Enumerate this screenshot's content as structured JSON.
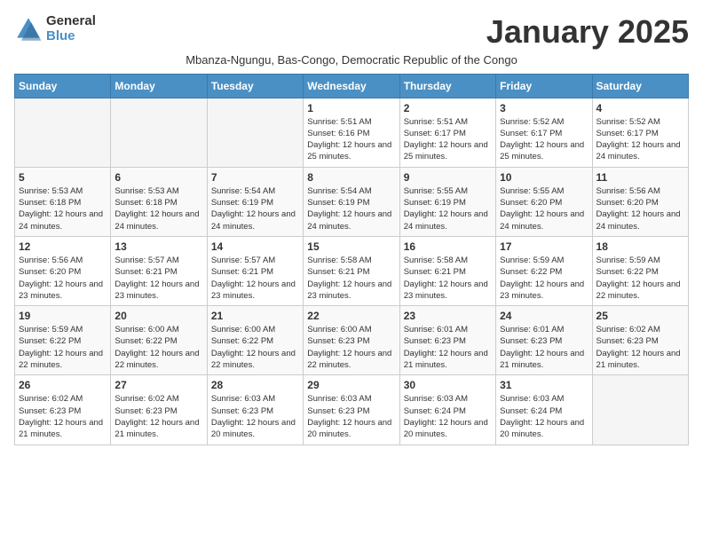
{
  "logo": {
    "general": "General",
    "blue": "Blue"
  },
  "title": "January 2025",
  "subtitle": "Mbanza-Ngungu, Bas-Congo, Democratic Republic of the Congo",
  "days_of_week": [
    "Sunday",
    "Monday",
    "Tuesday",
    "Wednesday",
    "Thursday",
    "Friday",
    "Saturday"
  ],
  "weeks": [
    [
      {
        "day": "",
        "empty": true
      },
      {
        "day": "",
        "empty": true
      },
      {
        "day": "",
        "empty": true
      },
      {
        "day": "1",
        "sunrise": "5:51 AM",
        "sunset": "6:16 PM",
        "daylight": "12 hours and 25 minutes."
      },
      {
        "day": "2",
        "sunrise": "5:51 AM",
        "sunset": "6:17 PM",
        "daylight": "12 hours and 25 minutes."
      },
      {
        "day": "3",
        "sunrise": "5:52 AM",
        "sunset": "6:17 PM",
        "daylight": "12 hours and 25 minutes."
      },
      {
        "day": "4",
        "sunrise": "5:52 AM",
        "sunset": "6:17 PM",
        "daylight": "12 hours and 24 minutes."
      }
    ],
    [
      {
        "day": "5",
        "sunrise": "5:53 AM",
        "sunset": "6:18 PM",
        "daylight": "12 hours and 24 minutes."
      },
      {
        "day": "6",
        "sunrise": "5:53 AM",
        "sunset": "6:18 PM",
        "daylight": "12 hours and 24 minutes."
      },
      {
        "day": "7",
        "sunrise": "5:54 AM",
        "sunset": "6:19 PM",
        "daylight": "12 hours and 24 minutes."
      },
      {
        "day": "8",
        "sunrise": "5:54 AM",
        "sunset": "6:19 PM",
        "daylight": "12 hours and 24 minutes."
      },
      {
        "day": "9",
        "sunrise": "5:55 AM",
        "sunset": "6:19 PM",
        "daylight": "12 hours and 24 minutes."
      },
      {
        "day": "10",
        "sunrise": "5:55 AM",
        "sunset": "6:20 PM",
        "daylight": "12 hours and 24 minutes."
      },
      {
        "day": "11",
        "sunrise": "5:56 AM",
        "sunset": "6:20 PM",
        "daylight": "12 hours and 24 minutes."
      }
    ],
    [
      {
        "day": "12",
        "sunrise": "5:56 AM",
        "sunset": "6:20 PM",
        "daylight": "12 hours and 23 minutes."
      },
      {
        "day": "13",
        "sunrise": "5:57 AM",
        "sunset": "6:21 PM",
        "daylight": "12 hours and 23 minutes."
      },
      {
        "day": "14",
        "sunrise": "5:57 AM",
        "sunset": "6:21 PM",
        "daylight": "12 hours and 23 minutes."
      },
      {
        "day": "15",
        "sunrise": "5:58 AM",
        "sunset": "6:21 PM",
        "daylight": "12 hours and 23 minutes."
      },
      {
        "day": "16",
        "sunrise": "5:58 AM",
        "sunset": "6:21 PM",
        "daylight": "12 hours and 23 minutes."
      },
      {
        "day": "17",
        "sunrise": "5:59 AM",
        "sunset": "6:22 PM",
        "daylight": "12 hours and 23 minutes."
      },
      {
        "day": "18",
        "sunrise": "5:59 AM",
        "sunset": "6:22 PM",
        "daylight": "12 hours and 22 minutes."
      }
    ],
    [
      {
        "day": "19",
        "sunrise": "5:59 AM",
        "sunset": "6:22 PM",
        "daylight": "12 hours and 22 minutes."
      },
      {
        "day": "20",
        "sunrise": "6:00 AM",
        "sunset": "6:22 PM",
        "daylight": "12 hours and 22 minutes."
      },
      {
        "day": "21",
        "sunrise": "6:00 AM",
        "sunset": "6:22 PM",
        "daylight": "12 hours and 22 minutes."
      },
      {
        "day": "22",
        "sunrise": "6:00 AM",
        "sunset": "6:23 PM",
        "daylight": "12 hours and 22 minutes."
      },
      {
        "day": "23",
        "sunrise": "6:01 AM",
        "sunset": "6:23 PM",
        "daylight": "12 hours and 21 minutes."
      },
      {
        "day": "24",
        "sunrise": "6:01 AM",
        "sunset": "6:23 PM",
        "daylight": "12 hours and 21 minutes."
      },
      {
        "day": "25",
        "sunrise": "6:02 AM",
        "sunset": "6:23 PM",
        "daylight": "12 hours and 21 minutes."
      }
    ],
    [
      {
        "day": "26",
        "sunrise": "6:02 AM",
        "sunset": "6:23 PM",
        "daylight": "12 hours and 21 minutes."
      },
      {
        "day": "27",
        "sunrise": "6:02 AM",
        "sunset": "6:23 PM",
        "daylight": "12 hours and 21 minutes."
      },
      {
        "day": "28",
        "sunrise": "6:03 AM",
        "sunset": "6:23 PM",
        "daylight": "12 hours and 20 minutes."
      },
      {
        "day": "29",
        "sunrise": "6:03 AM",
        "sunset": "6:23 PM",
        "daylight": "12 hours and 20 minutes."
      },
      {
        "day": "30",
        "sunrise": "6:03 AM",
        "sunset": "6:24 PM",
        "daylight": "12 hours and 20 minutes."
      },
      {
        "day": "31",
        "sunrise": "6:03 AM",
        "sunset": "6:24 PM",
        "daylight": "12 hours and 20 minutes."
      },
      {
        "day": "",
        "empty": true
      }
    ]
  ]
}
